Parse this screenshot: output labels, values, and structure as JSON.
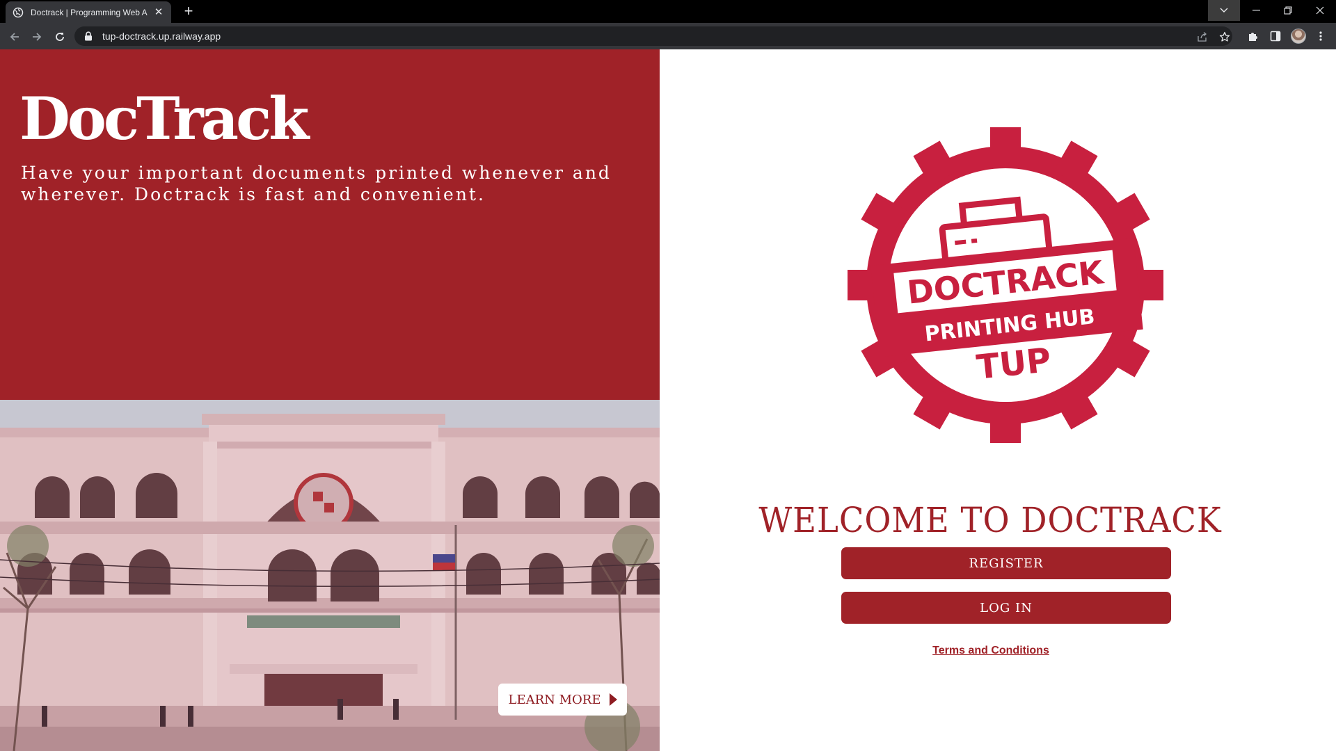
{
  "browser": {
    "tab_title": "Doctrack | Programming Web Ap",
    "url": "tup-doctrack.up.railway.app",
    "new_tab_label": "+",
    "close_tab_label": "✕"
  },
  "hero": {
    "brand": "DocTrack",
    "tagline": "Have your important documents printed whenever and wherever. Doctrack is fast and convenient.",
    "learn_more_label": "LEARN MORE"
  },
  "logo": {
    "line1": "DOCTRACK",
    "line2": "PRINTING HUB",
    "line3": "TUP"
  },
  "auth": {
    "welcome": "WELCOME TO DOCTRACK",
    "register_label": "REGISTER",
    "login_label": "LOG IN",
    "terms_label": "Terms and Conditions"
  },
  "colors": {
    "brand_red": "#a02228",
    "logo_red": "#c8203f",
    "chrome_dark": "#35363a"
  }
}
